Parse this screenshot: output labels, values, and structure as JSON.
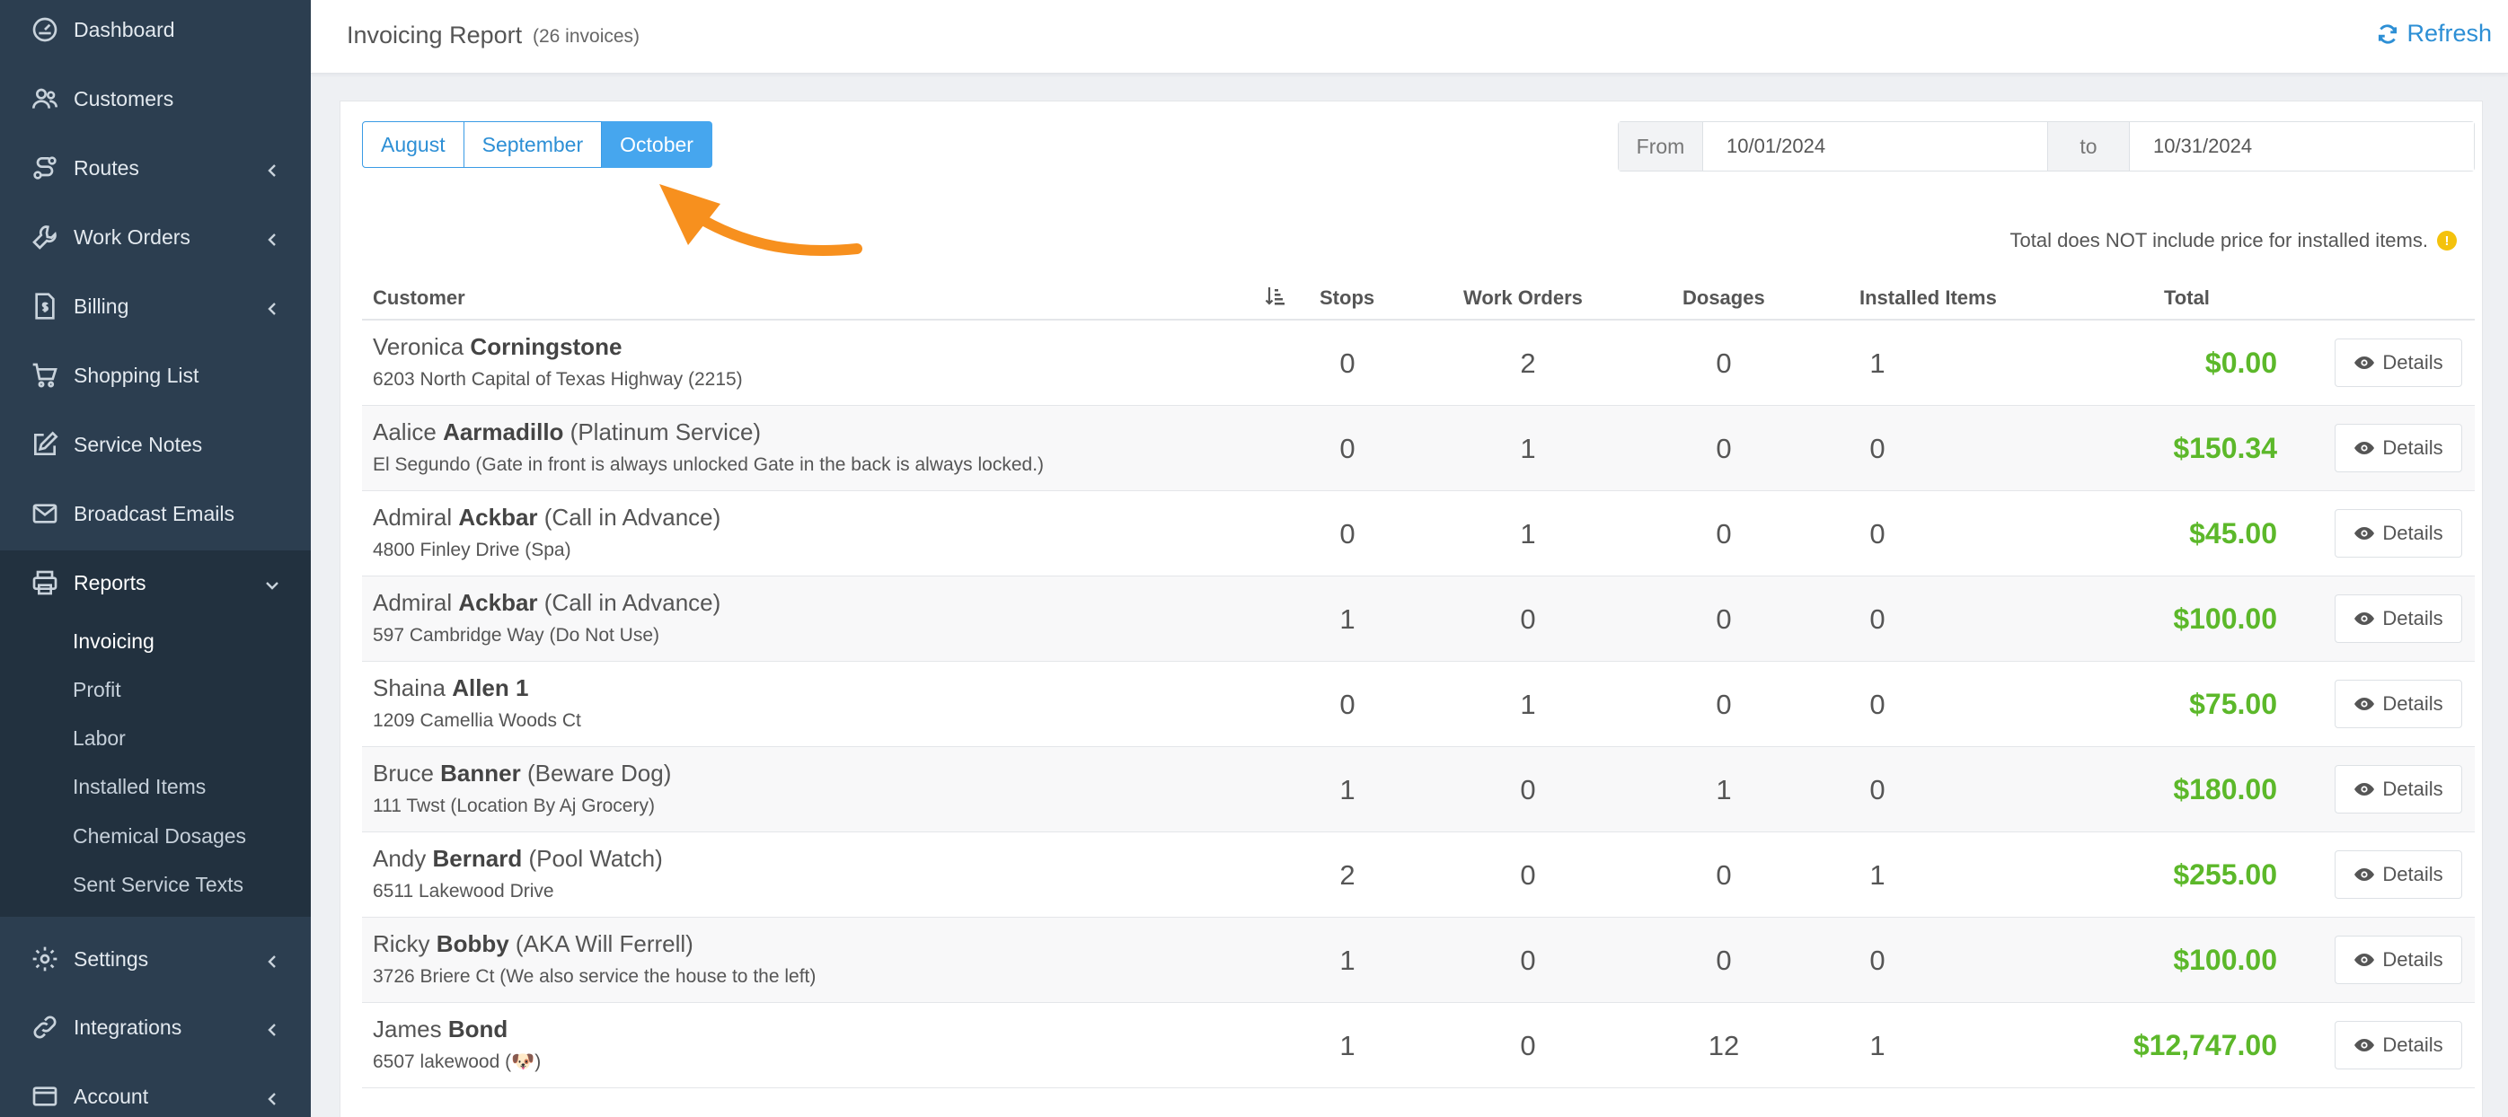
{
  "sidebar": {
    "items": [
      {
        "label": "Dashboard",
        "icon": "dashboard-icon"
      },
      {
        "label": "Customers",
        "icon": "users-icon"
      },
      {
        "label": "Routes",
        "icon": "route-icon"
      },
      {
        "label": "Work Orders",
        "icon": "wrench-icon"
      },
      {
        "label": "Billing",
        "icon": "billing-icon"
      },
      {
        "label": "Shopping List",
        "icon": "cart-icon"
      },
      {
        "label": "Service Notes",
        "icon": "edit-icon"
      },
      {
        "label": "Broadcast Emails",
        "icon": "envelope-icon"
      },
      {
        "label": "Reports",
        "icon": "print-icon"
      },
      {
        "label": "Settings",
        "icon": "gear-icon"
      },
      {
        "label": "Integrations",
        "icon": "link-icon"
      },
      {
        "label": "Account",
        "icon": "account-icon"
      }
    ],
    "reports_submenu": [
      "Invoicing",
      "Profit",
      "Labor",
      "Installed Items",
      "Chemical Dosages",
      "Sent Service Texts"
    ]
  },
  "header": {
    "title": "Invoicing Report",
    "count": "(26 invoices)",
    "refresh_label": "Refresh"
  },
  "filters": {
    "months": [
      "August",
      "September",
      "October"
    ],
    "active_month": "October",
    "from_label": "From",
    "from_value": "10/01/2024",
    "to_label": "to",
    "to_value": "10/31/2024"
  },
  "note": "Total does NOT include price for installed items.",
  "table": {
    "headers": [
      "Customer",
      "Stops",
      "Work Orders",
      "Dosages",
      "Installed Items",
      "Total"
    ],
    "details_label": "Details",
    "rows": [
      {
        "first": "Veronica",
        "last": "Corningstone",
        "tag": "",
        "address": "6203 North Capital of Texas Highway (2215)",
        "stops": "0",
        "work_orders": "2",
        "dosages": "0",
        "installed": "1",
        "total": "$0.00"
      },
      {
        "first": "Aalice",
        "last": "Aarmadillo",
        "tag": "(Platinum Service)",
        "address": "El Segundo (Gate in front is always unlocked Gate in the back is always locked.)",
        "stops": "0",
        "work_orders": "1",
        "dosages": "0",
        "installed": "0",
        "total": "$150.34"
      },
      {
        "first": "Admiral",
        "last": "Ackbar",
        "tag": "(Call in Advance)",
        "address": "4800 Finley Drive (Spa)",
        "stops": "0",
        "work_orders": "1",
        "dosages": "0",
        "installed": "0",
        "total": "$45.00"
      },
      {
        "first": "Admiral",
        "last": "Ackbar",
        "tag": "(Call in Advance)",
        "address": "597 Cambridge Way (Do Not Use)",
        "stops": "1",
        "work_orders": "0",
        "dosages": "0",
        "installed": "0",
        "total": "$100.00"
      },
      {
        "first": "Shaina",
        "last": "Allen 1",
        "tag": "",
        "address": "1209 Camellia Woods Ct",
        "stops": "0",
        "work_orders": "1",
        "dosages": "0",
        "installed": "0",
        "total": "$75.00"
      },
      {
        "first": "Bruce",
        "last": "Banner",
        "tag": "(Beware Dog)",
        "address": "111 Twst (Location By Aj Grocery)",
        "stops": "1",
        "work_orders": "0",
        "dosages": "1",
        "installed": "0",
        "total": "$180.00"
      },
      {
        "first": "Andy",
        "last": "Bernard",
        "tag": "(Pool Watch)",
        "address": "6511 Lakewood Drive",
        "stops": "2",
        "work_orders": "0",
        "dosages": "0",
        "installed": "1",
        "total": "$255.00"
      },
      {
        "first": "Ricky",
        "last": "Bobby",
        "tag": "(AKA Will Ferrell)",
        "address": "3726 Briere Ct (We also service the house to the left)",
        "stops": "1",
        "work_orders": "0",
        "dosages": "0",
        "installed": "0",
        "total": "$100.00"
      },
      {
        "first": "James",
        "last": "Bond",
        "tag": "",
        "address": "6507 lakewood (🐶)",
        "stops": "1",
        "work_orders": "0",
        "dosages": "12",
        "installed": "1",
        "total": "$12,747.00"
      }
    ]
  },
  "colors": {
    "sidebar_bg": "#2c3e50",
    "accent": "#46a6ee",
    "total_green": "#5cb82a",
    "arrow_orange": "#f7901e"
  }
}
